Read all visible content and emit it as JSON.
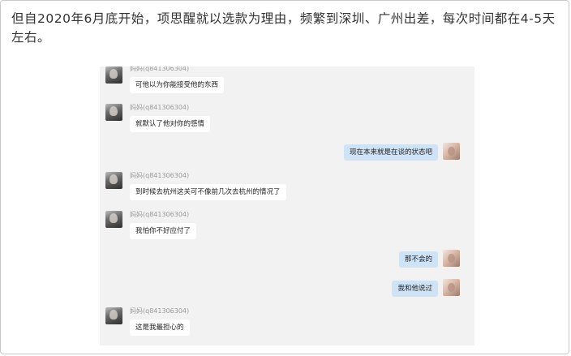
{
  "article": {
    "text": "但自2020年6月底开始，项思醒就以选款为理由，频繁到深圳、广州出差，每次时间都在4-5天左右。"
  },
  "chat": {
    "contact_name": "妈妈(q841306304)",
    "messages": [
      {
        "side": "left",
        "sender": "妈妈(q841306304)",
        "text": "可他以为你能接受他的东西"
      },
      {
        "side": "left",
        "sender": "妈妈(q841306304)",
        "text": "就默认了他对你的感情"
      },
      {
        "side": "right",
        "text": "现在本来就是在谈的状态吧"
      },
      {
        "side": "left",
        "sender": "妈妈(q841306304)",
        "text": "到时候去杭州这关可不像前几次去杭州的情况了"
      },
      {
        "side": "left",
        "sender": "妈妈(q841306304)",
        "text": "我怕你不好应付了"
      },
      {
        "side": "right",
        "text": "那不会的"
      },
      {
        "side": "right",
        "text": "我和他说过"
      },
      {
        "side": "left",
        "sender": "妈妈(q841306304)",
        "text": "这是我最担心的"
      }
    ]
  }
}
